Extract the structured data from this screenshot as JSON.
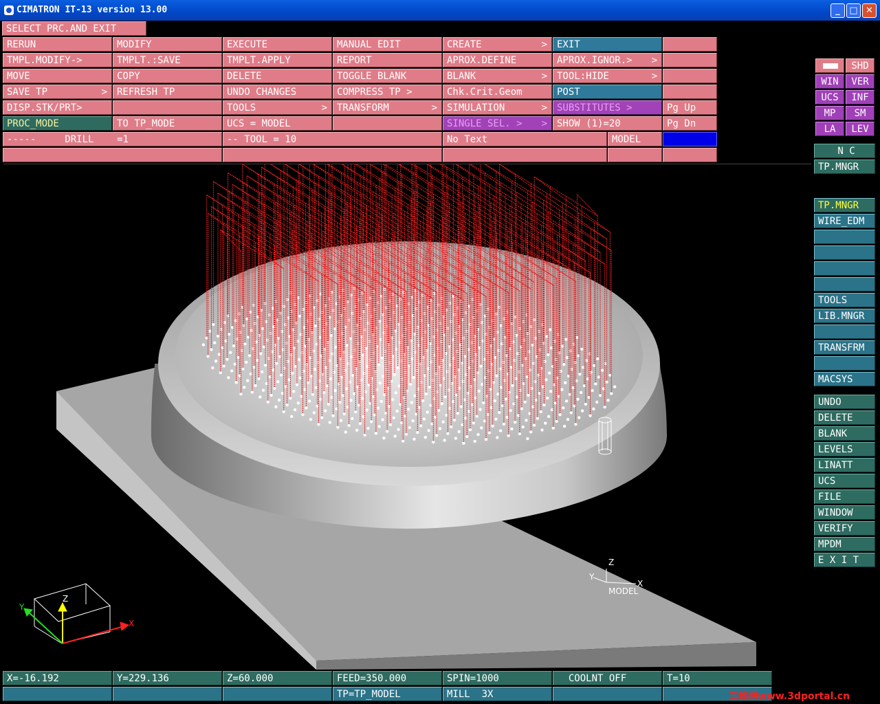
{
  "window": {
    "title": "CIMATRON IT-13 version 13.00",
    "buttons": {
      "minimize": "_",
      "maximize": "□",
      "close": "✕"
    }
  },
  "prompt": "SELECT PRC.AND EXIT",
  "menu": {
    "rows": [
      [
        "RERUN",
        "MODIFY",
        "EXECUTE",
        "MANUAL EDIT",
        "CREATE",
        "EXIT",
        ""
      ],
      [
        "TMPL.MODIFY->",
        "TMPLT.:SAVE",
        "TMPLT.APPLY",
        "REPORT",
        "APROX.DEFINE",
        "APROX.IGNOR.>",
        ""
      ],
      [
        "MOVE",
        "COPY",
        "DELETE",
        "TOGGLE BLANK",
        "BLANK",
        "TOOL:HIDE",
        ""
      ],
      [
        "SAVE TP",
        "REFRESH TP",
        "UNDO CHANGES",
        "COMPRESS TP >",
        "Chk.Crit.Geom",
        "POST",
        ""
      ],
      [
        "DISP.STK/PRT>",
        "",
        "TOOLS",
        "TRANSFORM",
        "SIMULATION",
        "SUBSTITUTES >",
        "Pg Up"
      ],
      [
        "PROC_MODE",
        "TO TP_MODE",
        "UCS = MODEL",
        "",
        "SINGLE SEL. >",
        "SHOW (1)=20",
        "Pg Dn"
      ]
    ],
    "arrows": ">",
    "drill_label": "-----     DRILL    =1",
    "tool_label": "-- TOOL = 10",
    "text_label": "No Text",
    "model_label": "MODEL"
  },
  "right_panel": {
    "grid": [
      [
        "",
        "SHD"
      ],
      [
        "WIN",
        "VER"
      ],
      [
        "UCS",
        "INF"
      ],
      [
        "MP",
        "SM"
      ],
      [
        "LA",
        "LEV"
      ]
    ],
    "nc": [
      "N C",
      "TP.MNGR"
    ],
    "tp_items": [
      "TP.MNGR",
      "WIRE_EDM",
      "",
      "",
      "",
      "",
      "TOOLS",
      "LIB.MNGR",
      "",
      "TRANSFRM",
      "",
      "MACSYS"
    ],
    "general": [
      "UNDO",
      "DELETE",
      "BLANK",
      "LEVELS",
      "LINATT",
      "UCS",
      "FILE",
      "WINDOW",
      "VERIFY",
      "MPDM",
      "E X I T"
    ]
  },
  "viewport": {
    "model_axis_label": "MODEL",
    "axis_x": "X",
    "axis_y": "Y",
    "axis_z": "Z"
  },
  "status": {
    "row1": [
      "X=-16.192",
      "Y=229.136",
      "Z=60.000",
      "FEED=350.000",
      "SPIN=1000",
      "  COOLNT OFF",
      "T=10"
    ],
    "row2": [
      "",
      "",
      "",
      "TP=TP_MODEL",
      "MILL  3X",
      "",
      ""
    ]
  },
  "watermark": "三维网www.3dportal.cn"
}
